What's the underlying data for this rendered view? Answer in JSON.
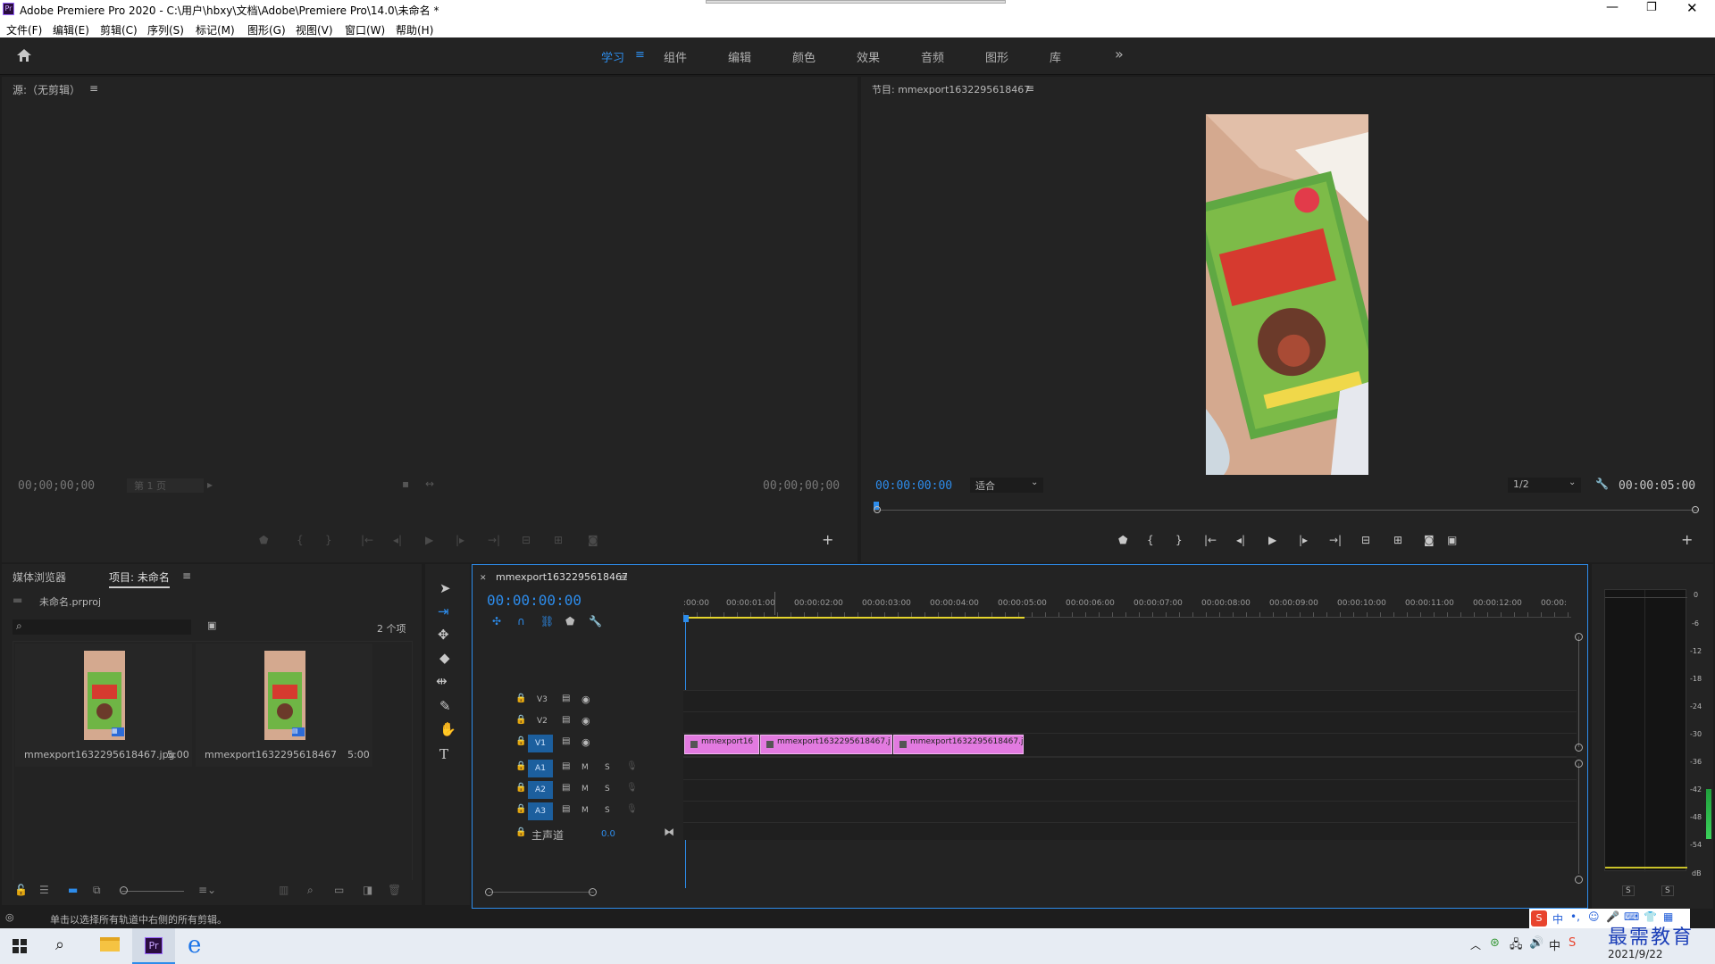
{
  "window": {
    "title": "Adobe Premiere Pro 2020 - C:\\用户\\hbxy\\文档\\Adobe\\Premiere Pro\\14.0\\未命名 *",
    "app_icon": "Pr"
  },
  "menu": [
    "文件(F)",
    "编辑(E)",
    "剪辑(C)",
    "序列(S)",
    "标记(M)",
    "图形(G)",
    "视图(V)",
    "窗口(W)",
    "帮助(H)"
  ],
  "workspaces": [
    "学习",
    "组件",
    "编辑",
    "颜色",
    "效果",
    "音频",
    "图形",
    "库"
  ],
  "source": {
    "title": "源:（无剪辑）",
    "tc_left": "00;00;00;00",
    "page": "第 1 页",
    "tc_right": "00;00;00;00"
  },
  "program": {
    "title": "节目: mmexport1632295618467",
    "tc": "00:00:00:00",
    "fit": "适合",
    "quality": "1/2",
    "duration": "00:00:05:00"
  },
  "project": {
    "tab_media": "媒体浏览器",
    "tab_project": "项目: 未命名",
    "file": "未命名.prproj",
    "count": "2 个项",
    "items": [
      {
        "name": "mmexport1632295618467.jpg",
        "dur": "5:00"
      },
      {
        "name": "mmexport1632295618467",
        "dur": "5:00"
      }
    ]
  },
  "timeline": {
    "seq_name": "mmexport1632295618467",
    "tc": "00:00:00:00",
    "ruler": [
      ":00:00",
      "00:00:01:00",
      "00:00:02:00",
      "00:00:03:00",
      "00:00:04:00",
      "00:00:05:00",
      "00:00:06:00",
      "00:00:07:00",
      "00:00:08:00",
      "00:00:09:00",
      "00:00:10:00",
      "00:00:11:00",
      "00:00:12:00",
      "00:00:"
    ],
    "video_tracks": [
      "V3",
      "V2",
      "V1"
    ],
    "audio_tracks": [
      "A1",
      "A2",
      "A3"
    ],
    "m": "M",
    "s": "S",
    "master": "主声道",
    "master_val": "0.0",
    "clips": [
      "mmexport16",
      "mmexport1632295618467.j",
      "mmexport1632295618467.j"
    ]
  },
  "meter": {
    "ticks": [
      "0",
      "-6",
      "-12",
      "-18",
      "-24",
      "-30",
      "-36",
      "-42",
      "-48",
      "-54",
      "dB"
    ],
    "s": "S"
  },
  "status": "单击以选择所有轨道中右侧的所有剪辑。",
  "tray": {
    "date": "2021/9/22",
    "ime": "中",
    "watermark": "最需教育"
  },
  "colors": {
    "accent": "#2d8ceb",
    "clip": "#e27ae0"
  }
}
